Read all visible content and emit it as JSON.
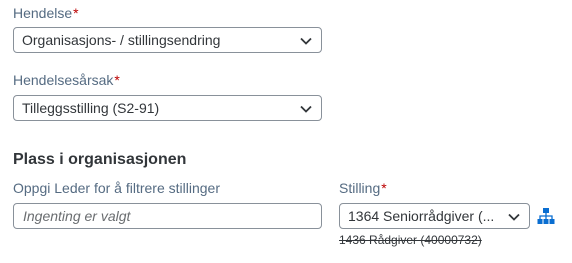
{
  "event": {
    "label": "Hendelse",
    "value": "Organisasjons- / stillingsendring"
  },
  "event_reason": {
    "label": "Hendelsesårsak",
    "value": "Tilleggsstilling (S2-91)"
  },
  "section": {
    "title": "Plass i organisasjonen"
  },
  "manager_filter": {
    "label": "Oppgi Leder for å filtrere stillinger",
    "placeholder": "Ingenting er valgt"
  },
  "position": {
    "label": "Stilling",
    "value": "1364 Seniorrådgiver (...",
    "previous_value": "1436 Rådgiver (40000732)"
  },
  "required_marker": "*",
  "icons": {
    "dropdown": "chevron-down-icon",
    "org_chart": "hierarchy-icon"
  },
  "colors": {
    "label": "#556b82",
    "required": "#bb0000",
    "accent": "#0a6ed1"
  }
}
